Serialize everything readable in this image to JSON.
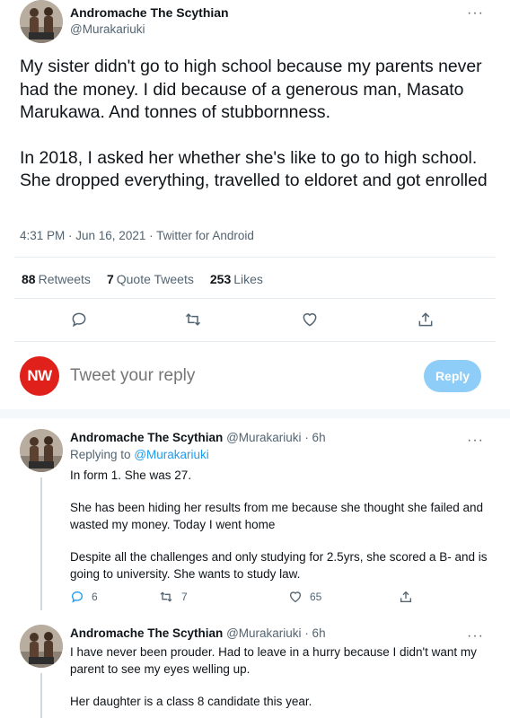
{
  "main_tweet": {
    "author_name": "Andromache The Scythian",
    "author_handle": "@Murakariuki",
    "more_label": "···",
    "paragraphs": [
      "My sister didn't go to high school because my parents never had the money. I did because of a generous man, Masato Marukawa. And tonnes of stubbornness.",
      "In 2018, I asked her whether she's like to go to high school. She dropped everything, travelled to eldoret and got enrolled"
    ],
    "timestamp": "4:31 PM · Jun 16, 2021 · Twitter for Android",
    "stats": {
      "retweets_count": "88",
      "retweets_label": "Retweets",
      "quotes_count": "7",
      "quotes_label": "Quote Tweets",
      "likes_count": "253",
      "likes_label": "Likes"
    },
    "action_icons": [
      "reply-icon",
      "retweet-icon",
      "like-icon",
      "share-icon"
    ]
  },
  "reply_box": {
    "avatar_text": "NW",
    "placeholder": "Tweet your reply",
    "button_label": "Reply"
  },
  "replies": [
    {
      "author_name": "Andromache The Scythian",
      "author_handle": "@Murakariuki",
      "time": "· 6h",
      "more_label": "···",
      "replying_prefix": "Replying to",
      "replying_handle": "@Murakariuki",
      "paragraphs": [
        "In form 1. She was 27.",
        "She has been hiding her results from me because she thought she failed and wasted my money. Today I went home",
        "Despite all the challenges and only studying for 2.5yrs, she scored a B- and is going to university.  She wants to study law."
      ],
      "reply_count": "6",
      "retweet_count": "7",
      "like_count": "65"
    },
    {
      "author_name": "Andromache The Scythian",
      "author_handle": "@Murakariuki",
      "time": "· 6h",
      "more_label": "···",
      "paragraphs": [
        "I have never been prouder. Had to leave in a hurry because I didn't want my parent to see my eyes welling up.",
        "Her daughter is a class 8 candidate this year."
      ]
    }
  ],
  "colors": {
    "accent": "#1d9bf0",
    "reply_button": "#8ecdf7",
    "nw_avatar": "#e0201a",
    "muted_text": "#536471"
  }
}
